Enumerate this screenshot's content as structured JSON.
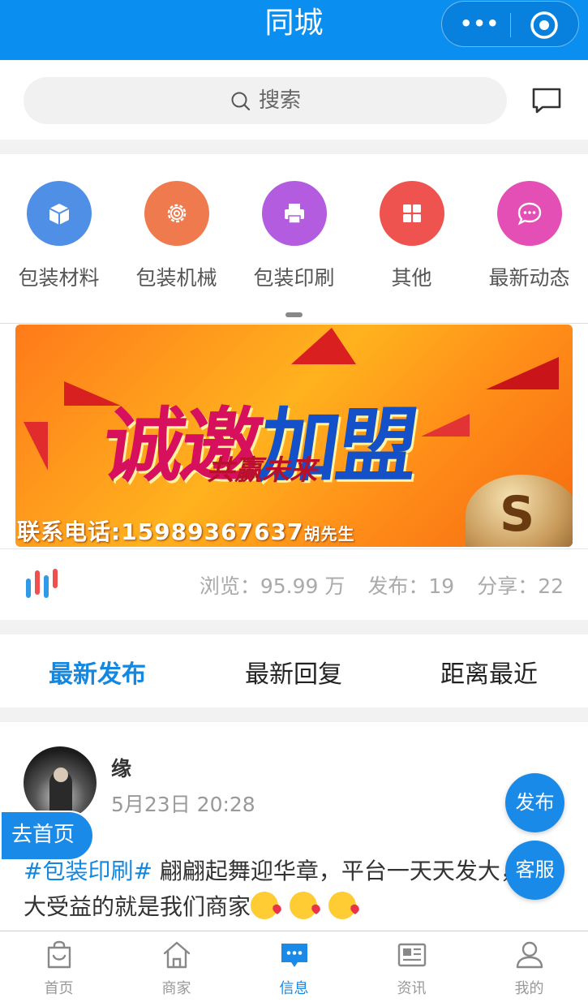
{
  "app": {
    "title": "同城"
  },
  "capsule": {
    "more_label": "•••"
  },
  "search": {
    "placeholder": "搜索"
  },
  "categories": [
    {
      "label": "包装材料",
      "icon": "box-icon",
      "color": "#4f8fe6"
    },
    {
      "label": "包装机械",
      "icon": "gear-icon",
      "color": "#ee7a4e"
    },
    {
      "label": "包装印刷",
      "icon": "printer-icon",
      "color": "#b35ce0"
    },
    {
      "label": "其他",
      "icon": "grid-icon",
      "color": "#ef5350"
    },
    {
      "label": "最新动态",
      "icon": "chat-bubble-icon",
      "color": "#e44fb5"
    }
  ],
  "banner": {
    "headline_1": "诚邀",
    "headline_2": "加盟",
    "subline": "共赢未来",
    "contact": "联系电话:15989367637",
    "contact_name": "胡先生",
    "bag_letter": "S"
  },
  "stats": {
    "views": "浏览：95.99 万",
    "posts": "发布：19",
    "shares": "分享：22"
  },
  "tabs": [
    {
      "label": "最新发布",
      "active": true
    },
    {
      "label": "最新回复",
      "active": false
    },
    {
      "label": "距离最近",
      "active": false
    }
  ],
  "post": {
    "author": "缘",
    "time": "5月23日 20:28",
    "tag": "#包装印刷#",
    "text": " 翩翩起舞迎华章，平台一天天发大，最大受益的就是我们商家"
  },
  "floating": {
    "home": "去首页",
    "publish": "发布",
    "service": "客服"
  },
  "tabbar": [
    {
      "label": "首页",
      "icon": "bag-icon",
      "active": false
    },
    {
      "label": "商家",
      "icon": "shop-icon",
      "active": false
    },
    {
      "label": "信息",
      "icon": "message-icon",
      "active": true
    },
    {
      "label": "资讯",
      "icon": "news-icon",
      "active": false
    },
    {
      "label": "我的",
      "icon": "profile-icon",
      "active": false
    }
  ]
}
